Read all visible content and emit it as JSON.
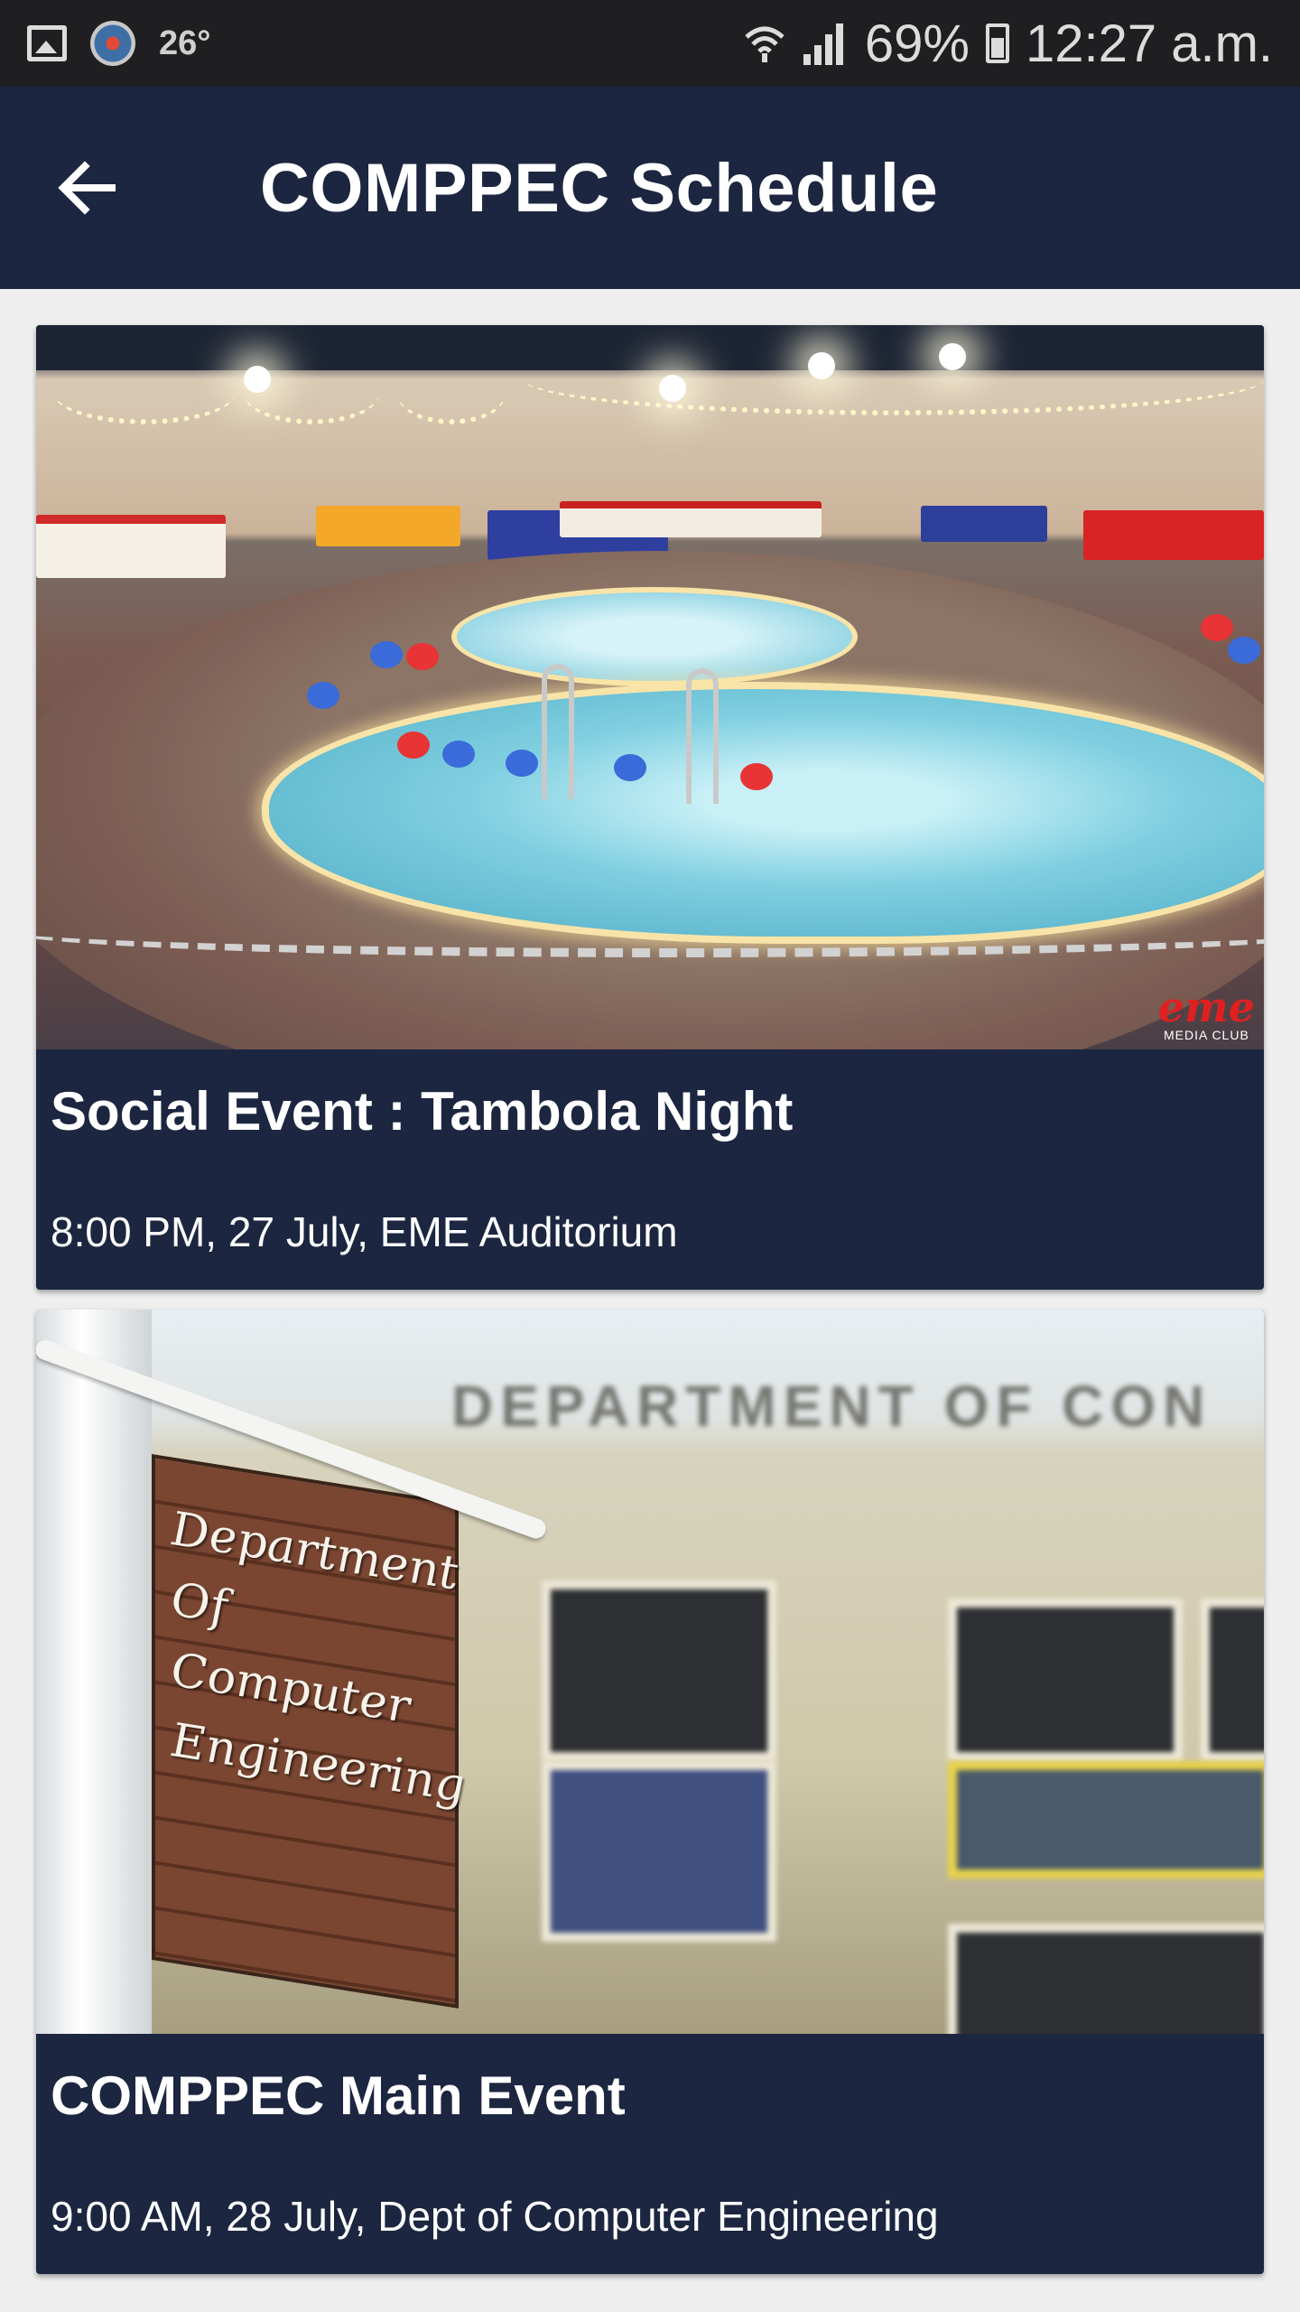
{
  "status_bar": {
    "temperature": "26°",
    "battery": "69%",
    "time": "12:27 a.m."
  },
  "app_bar": {
    "title": "COMPPEC Schedule"
  },
  "events": [
    {
      "title": "Social Event : Tambola Night",
      "details": "8:00 PM, 27 July, EME Auditorium",
      "image_watermark": "eme MEDIA CLUB"
    },
    {
      "title": "COMPPEC Main Event",
      "details": "9:00 AM, 28 July, Dept of Computer Engineering",
      "image_sign_text": "Department Of Computer Engineering"
    }
  ],
  "colors": {
    "app_bar": "#1c2640",
    "status_bar": "#1f1f22",
    "background": "#eeeeee",
    "text": "#ffffff"
  }
}
